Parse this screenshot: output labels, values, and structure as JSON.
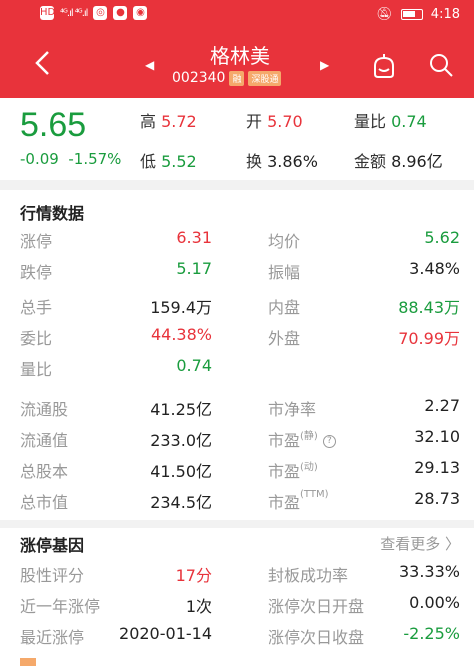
{
  "status": {
    "signal": "⁴ᴳ.ıl ⁴ᴳ.ıl",
    "time": "4:18"
  },
  "stock": {
    "name": "格林美",
    "code": "002340",
    "tag1": "融",
    "tag2": "深股通"
  },
  "quote": {
    "price": "5.65",
    "change": "-0.09",
    "change_pct": "-1.57%",
    "high_label": "高",
    "high": "5.72",
    "open_label": "开",
    "open": "5.70",
    "vr_label": "量比",
    "vr": "0.74",
    "low_label": "低",
    "low": "5.52",
    "turnover_label": "换",
    "turnover": "3.86%",
    "amount_label": "金额",
    "amount": "8.96亿"
  },
  "market": {
    "title": "行情数据",
    "rows": [
      {
        "l1": "涨停",
        "v1": "6.31",
        "l2": "均价",
        "v2": "5.62"
      },
      {
        "l1": "跌停",
        "v1": "5.17",
        "l2": "振幅",
        "v2": "3.48%"
      },
      {
        "l1": "总手",
        "v1": "159.4万",
        "l2": "内盘",
        "v2": "88.43万"
      },
      {
        "l1": "委比",
        "v1": "44.38%",
        "l2": "外盘",
        "v2": "70.99万"
      },
      {
        "l1": "量比",
        "v1": "0.74"
      },
      {
        "l1": "流通股",
        "v1": "41.25亿",
        "l2": "市净率",
        "v2": "2.27"
      },
      {
        "l1": "流通值",
        "v1": "233.0亿",
        "l2": "市盈",
        "l2sup": "(静)",
        "v2": "32.10"
      },
      {
        "l1": "总股本",
        "v1": "41.50亿",
        "l2": "市盈",
        "l2sup": "(动)",
        "v2": "29.13"
      },
      {
        "l1": "总市值",
        "v1": "234.5亿",
        "l2": "市盈",
        "l2sup": "(TTM)",
        "v2": "28.73"
      }
    ]
  },
  "gene": {
    "title": "涨停基因",
    "more": "查看更多 〉",
    "rows": [
      {
        "l1": "股性评分",
        "v1": "17分",
        "l2": "封板成功率",
        "v2": "33.33%"
      },
      {
        "l1": "近一年涨停",
        "v1": "1次",
        "l2": "涨停次日开盘",
        "v2": "0.00%"
      },
      {
        "l1": "最近涨停",
        "v1": "2020-01-14",
        "l2": "涨停次日收盘",
        "v2": "-2.25%"
      }
    ]
  },
  "colors": {
    "header": "#e8333b",
    "up": "#e8333b",
    "down": "#1a9c3e"
  }
}
